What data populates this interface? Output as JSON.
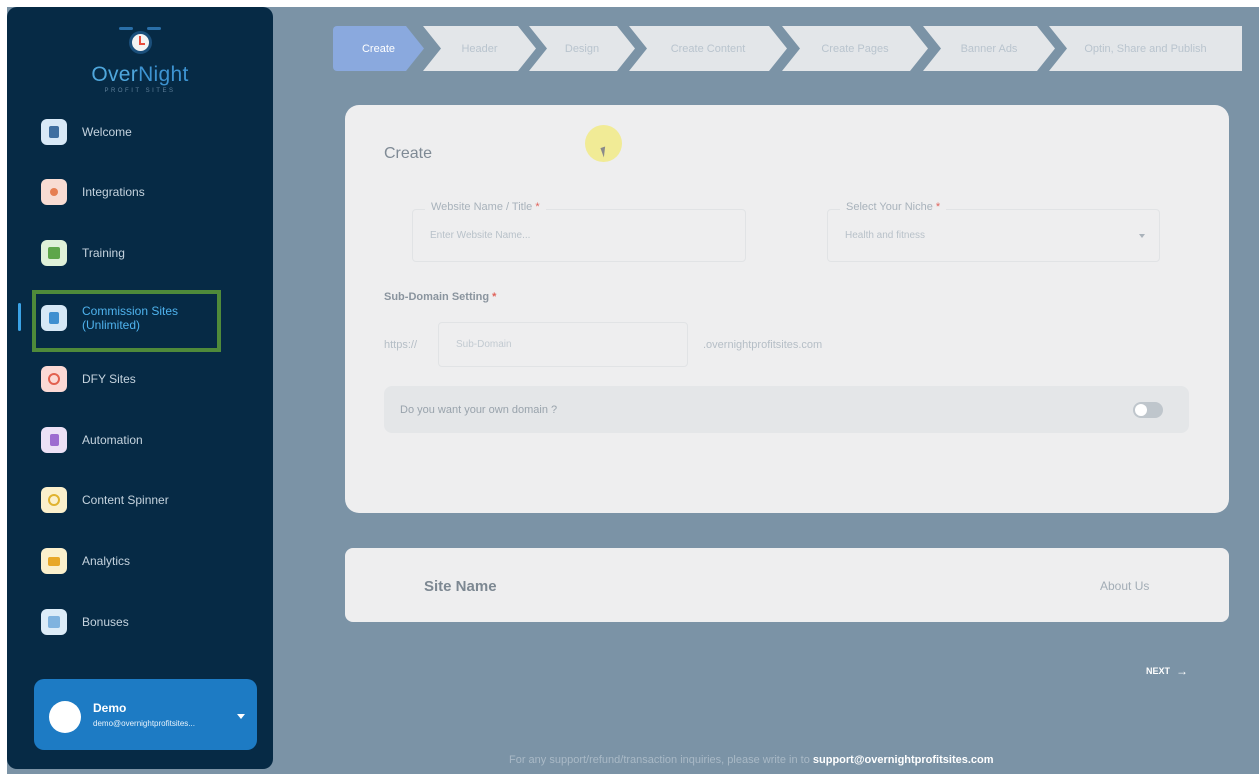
{
  "brand": {
    "name_part1": "Over",
    "name_part2": "Night",
    "tagline": "PROFIT SITES"
  },
  "sidebar": {
    "items": [
      {
        "label": "Welcome",
        "icon": "door-icon",
        "color": "#d8e9f7",
        "glyph": "#3f6fa0"
      },
      {
        "label": "Integrations",
        "icon": "integrations-icon",
        "color": "#f8dcd3",
        "glyph": "#e67e52"
      },
      {
        "label": "Training",
        "icon": "training-icon",
        "color": "#dff1d9",
        "glyph": "#5ea64a"
      },
      {
        "label": "Commission Sites",
        "label2": "(Unlimited)",
        "icon": "commission-sites-icon",
        "color": "#d6e8f6",
        "glyph": "#3f8fd0",
        "active": true
      },
      {
        "label": "DFY Sites",
        "icon": "dfy-sites-icon",
        "color": "#fbd9d5",
        "glyph": "#e2604f"
      },
      {
        "label": "Automation",
        "icon": "automation-icon",
        "color": "#ece1f6",
        "glyph": "#9c6bd0"
      },
      {
        "label": "Content Spinner",
        "icon": "spinner-icon",
        "color": "#fbf0cc",
        "glyph": "#e0b330"
      },
      {
        "label": "Analytics",
        "icon": "analytics-icon",
        "color": "#fbf0cc",
        "glyph": "#e8a828"
      },
      {
        "label": "Bonuses",
        "icon": "gift-icon",
        "color": "#dcecf8",
        "glyph": "#7fb3df"
      }
    ]
  },
  "user": {
    "name": "Demo",
    "email": "demo@overnightprofitsites..."
  },
  "steps": [
    "Create",
    "Header",
    "Design",
    "Create Content",
    "Create Pages",
    "Banner Ads",
    "Optin, Share and Publish"
  ],
  "form": {
    "title": "Create",
    "website_label": "Website Name / Title",
    "website_placeholder": "Enter Website Name...",
    "niche_label": "Select Your Niche",
    "niche_value": "Health and fitness",
    "subdomain_title": "Sub-Domain Setting",
    "https_prefix": "https://",
    "subdomain_placeholder": "Sub-Domain",
    "domain_suffix": ".overnightprofitsites.com",
    "own_domain_label": "Do you want your own domain ?",
    "own_domain_enabled": false,
    "required_mark": "*"
  },
  "preview": {
    "site_name": "Site Name",
    "about": "About Us"
  },
  "next_label": "NEXT",
  "next_arrow": "→",
  "footer": {
    "text": "For any support/refund/transaction inquiries, please write in to",
    "email": "support@overnightprofitsites.com"
  }
}
